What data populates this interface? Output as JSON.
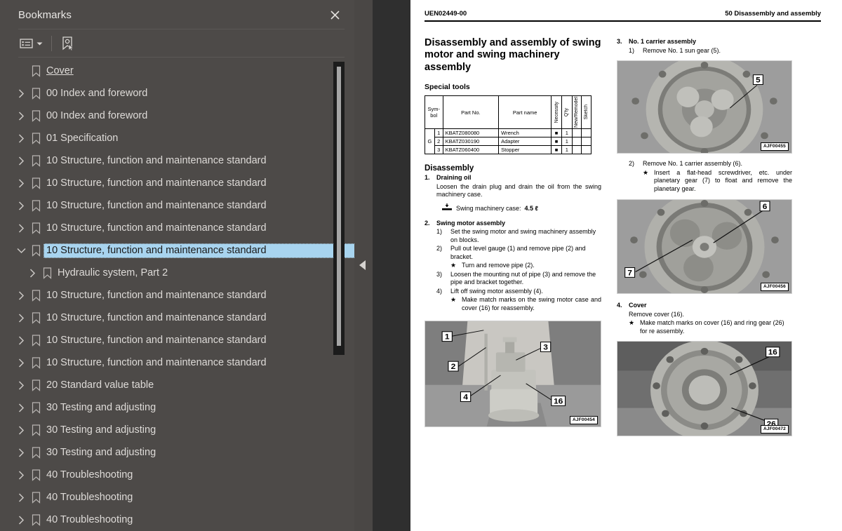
{
  "bookmarks_panel": {
    "title": "Bookmarks",
    "close_label": "✕",
    "toolbar": {
      "options_icon": "list-options-icon",
      "dropdown_icon": "chevron-down-icon",
      "new_bookmark_icon": "new-bookmark-icon"
    },
    "items": [
      {
        "label": "Cover",
        "depth": 0,
        "twisty": "none",
        "selected": false,
        "underline": true
      },
      {
        "label": "00 Index and foreword",
        "depth": 0,
        "twisty": "collapsed",
        "selected": false
      },
      {
        "label": "00 Index and foreword",
        "depth": 0,
        "twisty": "collapsed",
        "selected": false
      },
      {
        "label": "01 Specification",
        "depth": 0,
        "twisty": "collapsed",
        "selected": false
      },
      {
        "label": "10 Structure, function and maintenance standard",
        "depth": 0,
        "twisty": "collapsed",
        "selected": false
      },
      {
        "label": "10 Structure, function and maintenance standard",
        "depth": 0,
        "twisty": "collapsed",
        "selected": false
      },
      {
        "label": "10 Structure, function and maintenance standard",
        "depth": 0,
        "twisty": "collapsed",
        "selected": false
      },
      {
        "label": "10 Structure, function and maintenance standard",
        "depth": 0,
        "twisty": "collapsed",
        "selected": false
      },
      {
        "label": "10 Structure, function and maintenance standard",
        "depth": 0,
        "twisty": "expanded",
        "selected": true
      },
      {
        "label": "Hydraulic system, Part 2",
        "depth": 1,
        "twisty": "collapsed",
        "selected": false
      },
      {
        "label": "10 Structure, function and maintenance standard",
        "depth": 0,
        "twisty": "collapsed",
        "selected": false
      },
      {
        "label": "10 Structure, function and maintenance standard",
        "depth": 0,
        "twisty": "collapsed",
        "selected": false
      },
      {
        "label": "10 Structure, function and maintenance standard",
        "depth": 0,
        "twisty": "collapsed",
        "selected": false
      },
      {
        "label": "10 Structure, function and maintenance standard",
        "depth": 0,
        "twisty": "collapsed",
        "selected": false
      },
      {
        "label": "20 Standard value table",
        "depth": 0,
        "twisty": "collapsed",
        "selected": false
      },
      {
        "label": "30 Testing and adjusting",
        "depth": 0,
        "twisty": "collapsed",
        "selected": false
      },
      {
        "label": "30 Testing and adjusting",
        "depth": 0,
        "twisty": "collapsed",
        "selected": false
      },
      {
        "label": "30 Testing and adjusting",
        "depth": 0,
        "twisty": "collapsed",
        "selected": false
      },
      {
        "label": "40 Troubleshooting",
        "depth": 0,
        "twisty": "collapsed",
        "selected": false
      },
      {
        "label": "40 Troubleshooting",
        "depth": 0,
        "twisty": "collapsed",
        "selected": false
      },
      {
        "label": "40 Troubleshooting",
        "depth": 0,
        "twisty": "collapsed",
        "selected": false
      }
    ]
  },
  "splitter": {
    "collapse_icon": "collapse-left-arrow-icon"
  },
  "document": {
    "header_left": "UEN02449-00",
    "header_right": "50 Disassembly and assembly",
    "title": "Disassembly and assembly of swing motor and swing machinery assembly",
    "special_tools_heading": "Special tools",
    "tools_table": {
      "columns": [
        "Sym-bol",
        "Part No.",
        "Part name",
        "Necessity",
        "Q'ty",
        "New/Remodel",
        "Sketch"
      ],
      "group_symbol": "G",
      "rows": [
        {
          "no": "1",
          "part_no": "KBATZ080080",
          "part_name": "Wrench",
          "necessity": "■",
          "qty": "1",
          "new_remodel": "",
          "sketch": ""
        },
        {
          "no": "2",
          "part_no": "KBATZ030190",
          "part_name": "Adapter",
          "necessity": "■",
          "qty": "1",
          "new_remodel": "",
          "sketch": ""
        },
        {
          "no": "3",
          "part_no": "KBATZ060400",
          "part_name": "Stopper",
          "necessity": "■",
          "qty": "1",
          "new_remodel": "",
          "sketch": ""
        }
      ]
    },
    "disassembly_heading": "Disassembly",
    "step1": {
      "number": "1.",
      "title": "Draining oil",
      "body": "Loosen the drain plug and drain the oil from the swing machinery case.",
      "oil_icon": "drain-oil-icon",
      "oil_label": "Swing machinery case:",
      "oil_value": "4.5 ℓ"
    },
    "step2": {
      "number": "2.",
      "title": "Swing motor assembly",
      "substeps": [
        {
          "n": "1)",
          "text": "Set the swing motor and swing machinery assembly on blocks."
        },
        {
          "n": "2)",
          "text": "Pull out level gauge (1) and remove pipe (2) and bracket."
        },
        {
          "n": "★",
          "text": "Turn and remove pipe (2).",
          "star": true
        },
        {
          "n": "3)",
          "text": "Loosen the mounting nut of pipe (3) and remove the pipe and bracket together."
        },
        {
          "n": "4)",
          "text": "Lift off swing motor assembly (4)."
        },
        {
          "n": "★",
          "text": "Make match marks on the swing motor case and cover (16) for reassembly.",
          "star": true
        }
      ]
    },
    "step3": {
      "number": "3.",
      "title": "No. 1 carrier assembly",
      "substeps": [
        {
          "n": "1)",
          "text": "Remove No. 1 sun gear (5)."
        },
        {
          "n": "2)",
          "text": "Remove No. 1 carrier assembly (6)."
        },
        {
          "n": "★",
          "text": "Insert a flat-head screwdriver, etc. under planetary gear (7) to float and remove the planetary gear.",
          "star": true
        }
      ]
    },
    "step4": {
      "number": "4.",
      "title": "Cover",
      "body": "Remove cover (16).",
      "star_text": "Make match marks on cover (16) and ring gear (26) for re assembly."
    },
    "figures": [
      {
        "id": "fig-sun-gear",
        "caption": "AJF00455",
        "callouts": [
          "5"
        ]
      },
      {
        "id": "fig-carrier",
        "caption": "AJF00456",
        "callouts": [
          "6",
          "7"
        ]
      },
      {
        "id": "fig-swing-motor",
        "caption": "AJF00454",
        "callouts": [
          "1",
          "2",
          "3",
          "4",
          "16"
        ]
      },
      {
        "id": "fig-cover",
        "caption": "AJF00472",
        "callouts": [
          "16",
          "26"
        ]
      }
    ]
  },
  "colors": {
    "panel_bg": "#4d4a48",
    "selection_bg": "#a8d4ef",
    "text": "#dedbd8",
    "page_bg": "#ffffff",
    "app_bg": "#2b2b2b"
  }
}
